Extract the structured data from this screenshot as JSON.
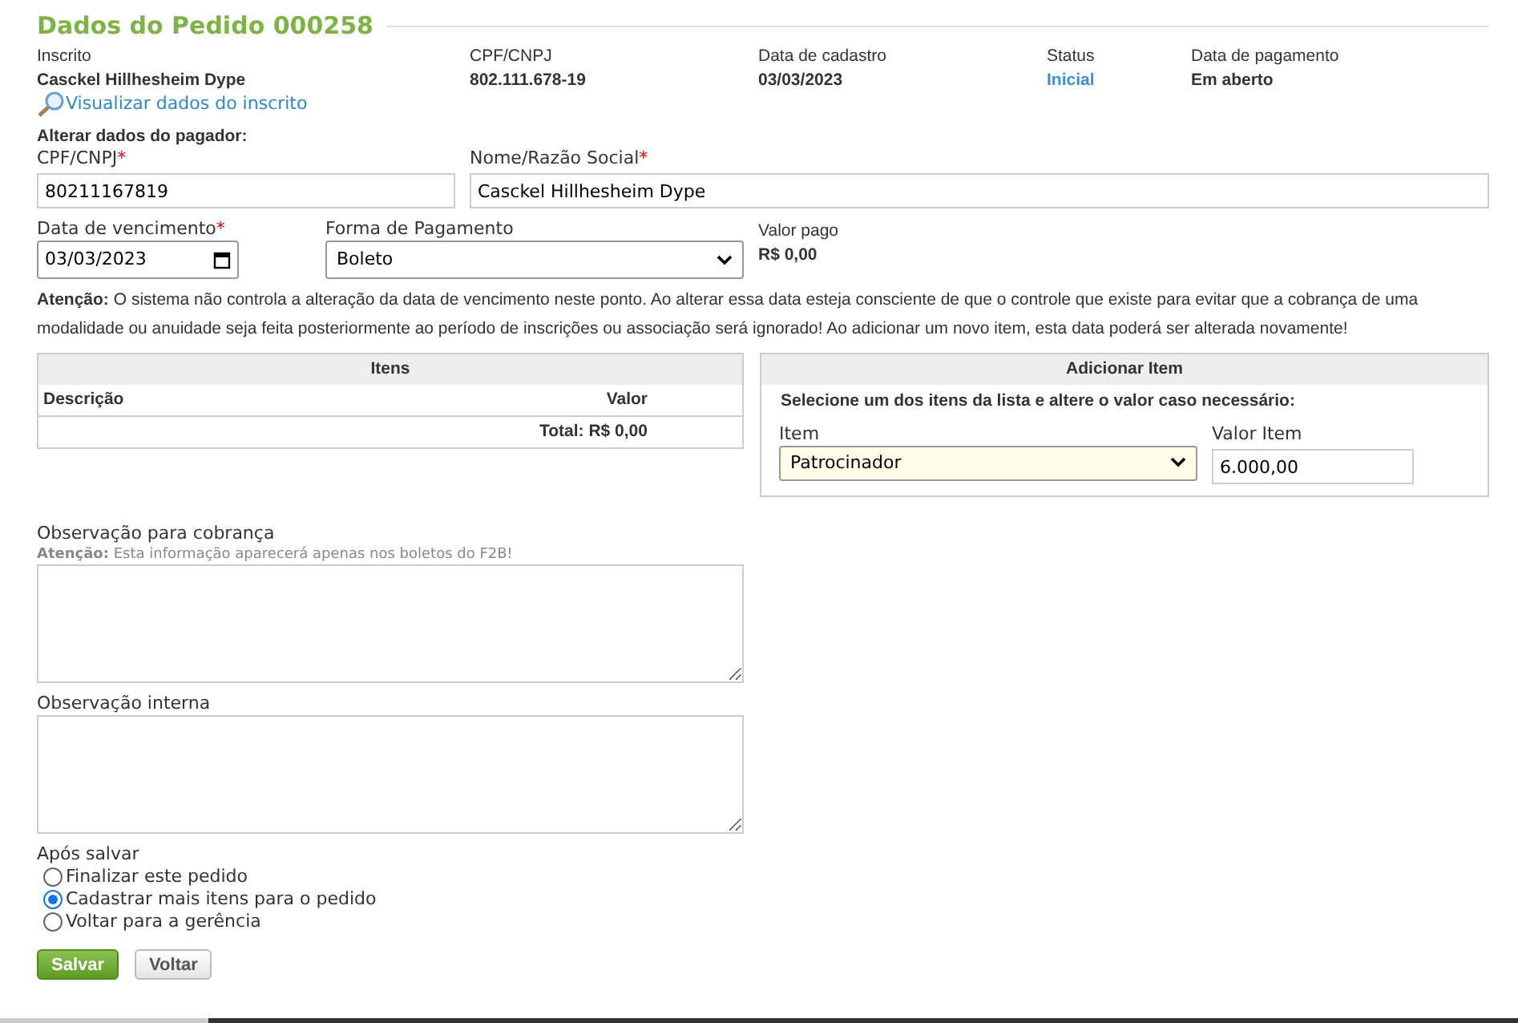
{
  "title": "Dados do Pedido 000258",
  "summary": [
    {
      "label": "Inscrito",
      "value": "Casckel Hillhesheim Dype",
      "kind": "plain"
    },
    {
      "label": "CPF/CNPJ",
      "value": "802.111.678-19",
      "kind": "plain"
    },
    {
      "label": "Data de cadastro",
      "value": "03/03/2023",
      "kind": "plain"
    },
    {
      "label": "Status",
      "value": "Inicial",
      "kind": "status"
    },
    {
      "label": "Data de pagamento",
      "value": "Em aberto",
      "kind": "plain"
    }
  ],
  "view_link": "Visualizar dados do inscrito",
  "payer_heading": "Alterar dados do pagador:",
  "cpf_field": {
    "label": "CPF/CNPJ",
    "required_mark": "*",
    "value": "80211167819"
  },
  "name_field": {
    "label": "Nome/Razão Social",
    "required_mark": "*",
    "value": "Casckel Hillhesheim Dype"
  },
  "due_date_field": {
    "label": "Data de vencimento",
    "required_mark": "*",
    "value": "03/03/2023"
  },
  "payment_field": {
    "label": "Forma de Pagamento",
    "value": "Boleto"
  },
  "paid": {
    "label": "Valor pago",
    "value": "R$ 0,00"
  },
  "warning": "**Atenção:** O sistema não controla a alteração da data de vencimento neste ponto. Ao alterar essa data esteja consciente de que o controle que existe para evitar que a cobrança de uma modalidade ou anuidade seja feita posteriormente ao período de inscrições ou associação será ignorado! Ao adicionar um novo item, esta data poderá ser alterada novamente!",
  "items_table": {
    "title": "Itens",
    "columns": [
      "Descrição",
      "Valor"
    ],
    "total": "Total: R$ 0,00"
  },
  "add_item": {
    "title": "Adicionar Item",
    "instruction": "Selecione um dos itens da lista e altere o valor caso necessário:",
    "item_label": "Item",
    "item_value": "Patrocinador",
    "amount_label": "Valor Item",
    "amount_value": "6.000,00"
  },
  "billing_note": {
    "label": "Observação para cobrança",
    "hint": "**Atenção:** Esta informação aparecerá apenas nos boletos do F2B!"
  },
  "internal_note": {
    "label": "Observação interna"
  },
  "after_save": {
    "label": "Após salvar",
    "options": [
      {
        "label": "Finalizar este pedido",
        "selected": false
      },
      {
        "label": "Cadastrar mais itens para o pedido",
        "selected": true
      },
      {
        "label": "Voltar para a gerência",
        "selected": false
      }
    ]
  },
  "buttons": [
    {
      "label": "Salvar",
      "kind": "primary"
    },
    {
      "label": "Voltar",
      "kind": "secondary"
    }
  ]
}
